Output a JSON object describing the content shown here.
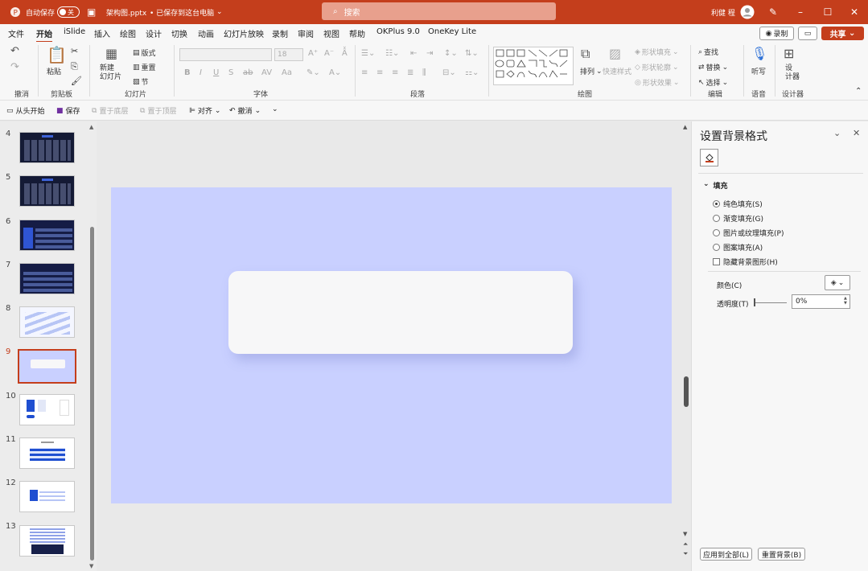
{
  "titlebar": {
    "autosave_label": "自动保存",
    "autosave_state": "关",
    "filename": "架构图.pptx",
    "save_status": "• 已保存到这台电脑",
    "search_placeholder": "搜索",
    "user_name": "利健 程"
  },
  "menu": [
    "文件",
    "开始",
    "iSlide",
    "插入",
    "绘图",
    "设计",
    "切换",
    "动画",
    "幻灯片放映",
    "录制",
    "审阅",
    "视图",
    "帮助",
    "OKPlus 9.0",
    "OneKey Lite"
  ],
  "menu_active": "开始",
  "top_buttons": {
    "record": "录制",
    "share": "共享"
  },
  "ribbon": {
    "groups": [
      "撤消",
      "剪贴板",
      "幻灯片",
      "字体",
      "段落",
      "绘图",
      "编辑",
      "语音",
      "设计器"
    ],
    "paste": "粘贴",
    "new_slide": "新建\n幻灯片",
    "layout": "版式",
    "reset": "重置",
    "section": "节",
    "font_size": "18",
    "arrange": "排列",
    "quick_styles": "快速样式",
    "shape_fill": "形状填充",
    "shape_outline": "形状轮廓",
    "shape_effects": "形状效果",
    "find": "查找",
    "replace": "替换",
    "select": "选择",
    "dictate": "听写",
    "designer": "设\n计器"
  },
  "qat": {
    "from_start": "从头开始",
    "save": "保存",
    "send_back": "置于底层",
    "bring_front": "置于顶层",
    "align": "对齐",
    "undo": "撤消"
  },
  "thumbnails": [
    {
      "num": "4"
    },
    {
      "num": "5"
    },
    {
      "num": "6"
    },
    {
      "num": "7"
    },
    {
      "num": "8"
    },
    {
      "num": "9"
    },
    {
      "num": "10"
    },
    {
      "num": "11"
    },
    {
      "num": "12"
    },
    {
      "num": "13"
    }
  ],
  "selected_slide": "9",
  "pane": {
    "title": "设置背景格式",
    "section": "填充",
    "options": [
      "纯色填充(S)",
      "渐变填充(G)",
      "图片或纹理填充(P)",
      "图案填充(A)"
    ],
    "selected_option": "纯色填充(S)",
    "hide_bg": "隐藏背景图形(H)",
    "color_label": "颜色(C)",
    "transparency_label": "透明度(T)",
    "transparency_value": "0%",
    "apply_all": "应用到全部(L)",
    "reset_bg": "重置背景(B)"
  },
  "colors": {
    "accent": "#c43e1c",
    "slide_bg": "#c9d0ff",
    "card": "#f7f7f8"
  }
}
